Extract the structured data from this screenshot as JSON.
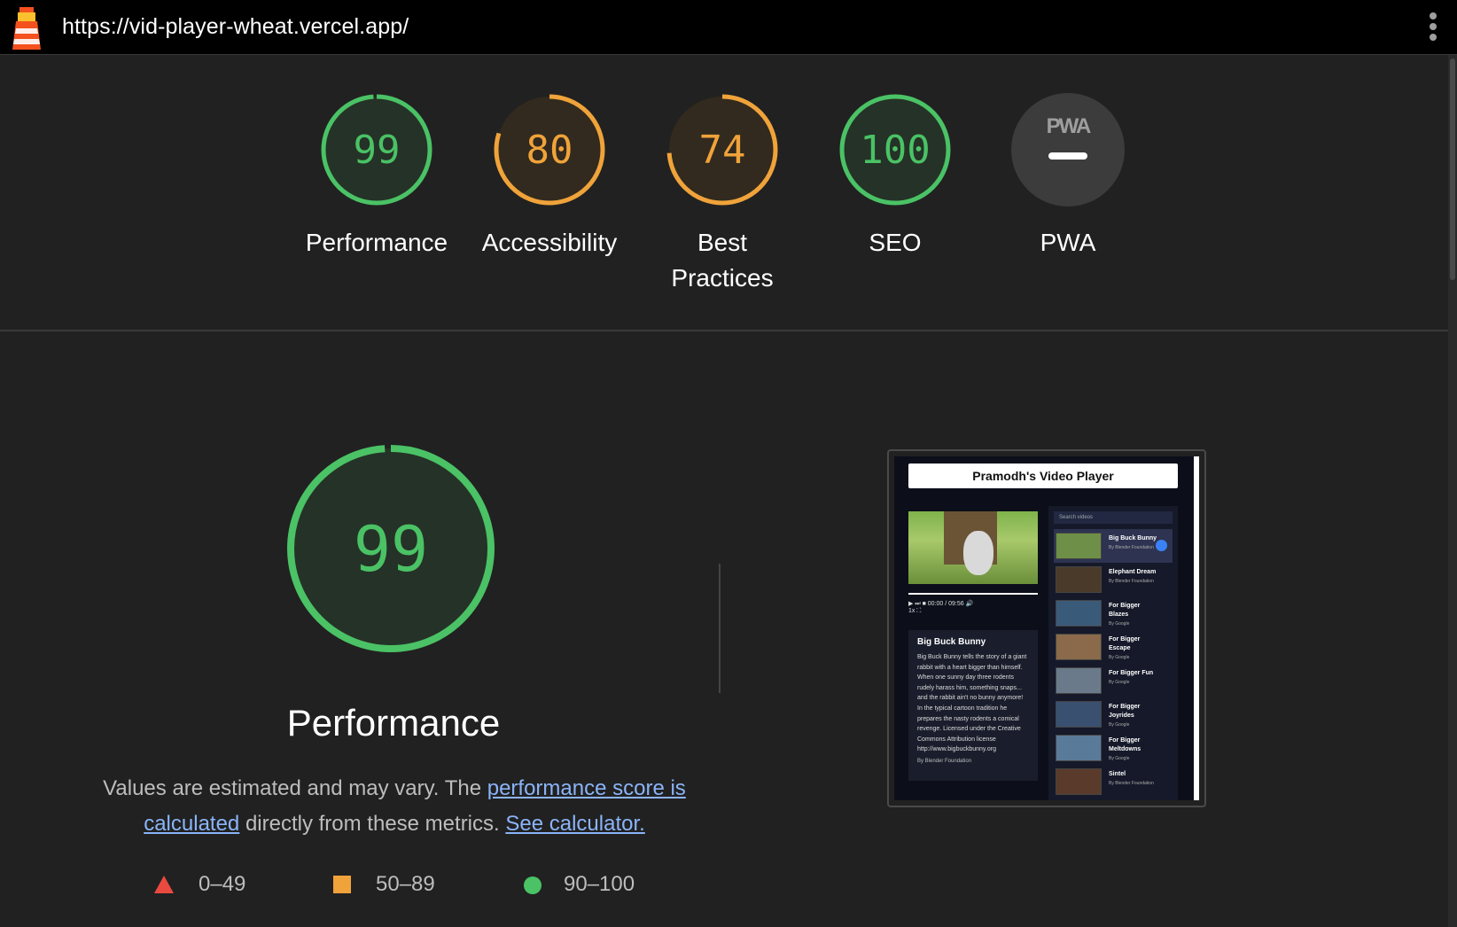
{
  "browser": {
    "url": "https://vid-player-wheat.vercel.app/"
  },
  "colors": {
    "pass": "#0cce6b",
    "average": "#ffa400",
    "fail": "#ff4e42"
  },
  "scores": [
    {
      "id": "performance",
      "value": "99",
      "label": "Performance",
      "fraction": 0.99,
      "color": "#4ac265"
    },
    {
      "id": "accessibility",
      "value": "80",
      "label": "Accessibility",
      "fraction": 0.8,
      "color": "#f0a33a"
    },
    {
      "id": "best-practices",
      "value": "74",
      "label": "Best Practices",
      "fraction": 0.74,
      "color": "#f0a33a"
    },
    {
      "id": "seo",
      "value": "100",
      "label": "SEO",
      "fraction": 1.0,
      "color": "#4ac265"
    },
    {
      "id": "pwa",
      "value": "PWA",
      "label": "PWA",
      "fraction": 0,
      "color": "#9e9e9e"
    }
  ],
  "performance": {
    "score": "99",
    "fraction": 0.99,
    "title": "Performance",
    "desc_prefix": "Values are estimated and may vary. The ",
    "desc_link1": "performance score is calculated",
    "desc_mid": " directly from these metrics. ",
    "desc_link2": "See calculator."
  },
  "legend": [
    {
      "shape": "triangle",
      "range": "0–49"
    },
    {
      "shape": "square",
      "range": "50–89"
    },
    {
      "shape": "circle",
      "range": "90–100"
    }
  ],
  "screenshot": {
    "title": "Pramodh's Video Player",
    "controls_time": "00:00 / 09:56",
    "speed": "1x",
    "video_title": "Big Buck Bunny",
    "video_desc": "Big Buck Bunny tells the story of a giant rabbit with a heart bigger than himself. When one sunny day three rodents rudely harass him, something snaps... and the rabbit ain't no bunny anymore! In the typical cartoon tradition he prepares the nasty rodents a comical revenge. Licensed under the Creative Commons Attribution license http://www.bigbuckbunny.org",
    "video_by": "By Blender Foundation",
    "search_placeholder": "Search videos",
    "items": [
      {
        "name": "Big Buck Bunny",
        "by": "By Blender Foundation"
      },
      {
        "name": "Elephant Dream",
        "by": "By Blender Foundation"
      },
      {
        "name": "For Bigger Blazes",
        "by": "By Google"
      },
      {
        "name": "For Bigger Escape",
        "by": "By Google"
      },
      {
        "name": "For Bigger Fun",
        "by": "By Google"
      },
      {
        "name": "For Bigger Joyrides",
        "by": "By Google"
      },
      {
        "name": "For Bigger Meltdowns",
        "by": "By Google"
      },
      {
        "name": "Sintel",
        "by": "By Blender Foundation"
      }
    ]
  }
}
